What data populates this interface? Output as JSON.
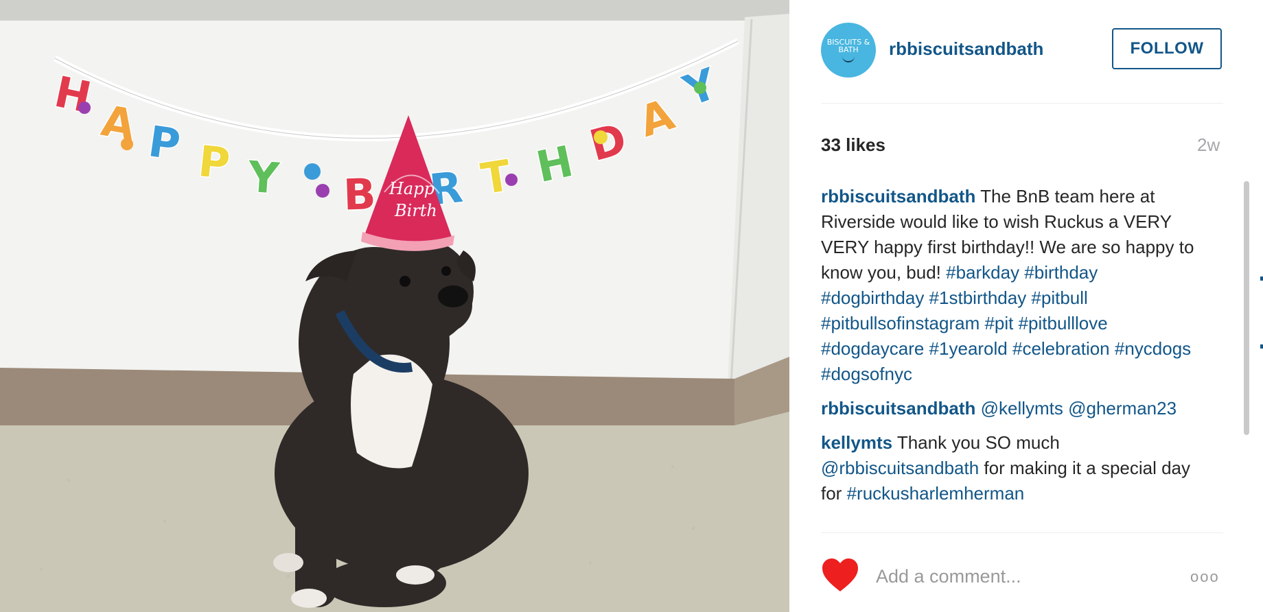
{
  "post": {
    "photo": {
      "banner_text": "HAPPY BIRTHDAY",
      "hat_text": "Happy Birthday"
    },
    "header": {
      "avatar_text": "BISCUITS & BATH",
      "username": "rbbiscuitsandbath",
      "follow_label": "FOLLOW"
    },
    "likes": "33 likes",
    "age": "2w",
    "comments": [
      {
        "user": "rbbiscuitsandbath",
        "text": " The BnB team here at Riverside would like to wish Ruckus a VERY VERY happy first birthday!! We are so happy to know you, bud! ",
        "tags": "#barkday #birthday #dogbirthday #1stbirthday #pitbull #pitbullsofinstagram #pit #pitbulllove #dogdaycare #1yearold #celebration #nycdogs #dogsofnyc"
      },
      {
        "user": "rbbiscuitsandbath",
        "text": " ",
        "tags": "@kellymts @gherman23"
      },
      {
        "user": "kellymts",
        "text": " Thank you SO much ",
        "mention": "@rbbiscuitsandbath",
        "text2": " for making it a special day for ",
        "tags": "#ruckusharlemherman"
      }
    ],
    "actions": {
      "like_icon": "heart-icon",
      "comment_placeholder": "Add a comment...",
      "more_label": "ooo"
    }
  },
  "colors": {
    "link": "#125688",
    "like": "#ed1f1f",
    "avatar_bg": "#48b6e0"
  }
}
